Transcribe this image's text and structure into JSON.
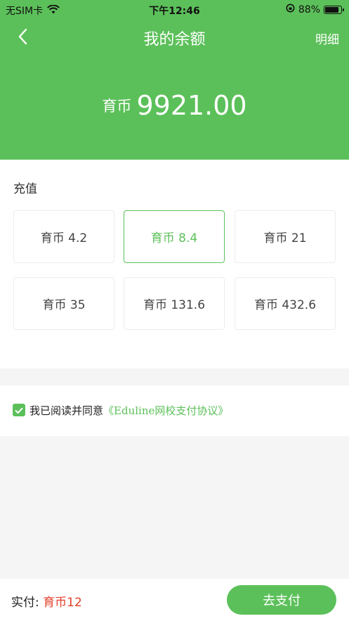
{
  "status_bar": {
    "carrier": "无SIM卡",
    "time": "下午12:46",
    "battery": "88%",
    "icons": [
      "wifi-icon",
      "orientation-lock-icon",
      "battery-icon"
    ]
  },
  "nav": {
    "title": "我的余额",
    "right_action": "明细",
    "back_icon": "chevron-left-icon"
  },
  "balance": {
    "unit": "育币",
    "amount": "9921.00"
  },
  "recharge": {
    "title": "充值",
    "options": [
      {
        "label": "育币 4.2",
        "selected": false
      },
      {
        "label": "育币 8.4",
        "selected": true
      },
      {
        "label": "育币 21",
        "selected": false
      },
      {
        "label": "育币 35",
        "selected": false
      },
      {
        "label": "育币 131.6",
        "selected": false
      },
      {
        "label": "育币 432.6",
        "selected": false
      }
    ]
  },
  "agreement": {
    "checked": true,
    "text": "我已阅读并同意",
    "link": "《Eduline网校支付协议》"
  },
  "footer": {
    "total_label": "实付:",
    "total_value": "育币12",
    "pay_button": "去支付"
  },
  "colors": {
    "primary": "#5cc05a",
    "price": "#e53f2a"
  }
}
